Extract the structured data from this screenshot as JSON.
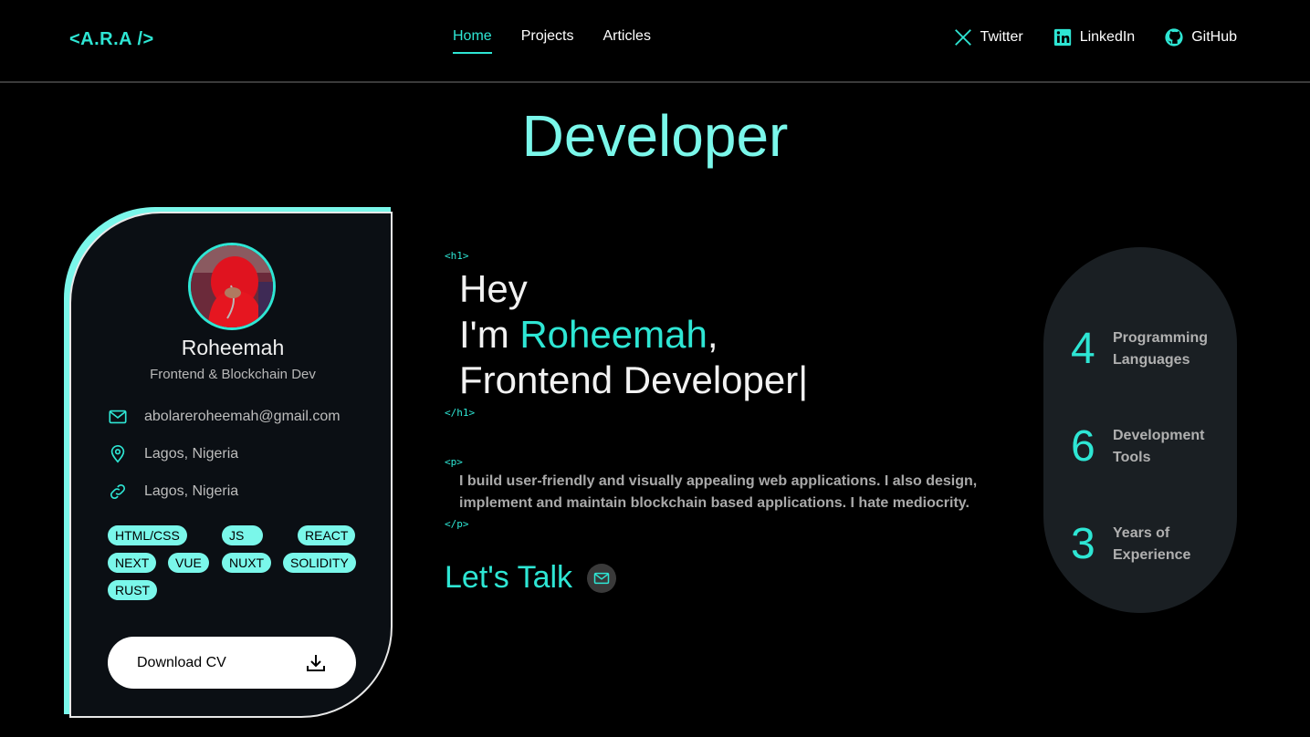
{
  "header": {
    "logo": "<A.R.A />",
    "nav": [
      {
        "label": "Home",
        "active": true
      },
      {
        "label": "Projects",
        "active": false
      },
      {
        "label": "Articles",
        "active": false
      }
    ],
    "social": [
      {
        "label": "Twitter",
        "icon": "x-icon"
      },
      {
        "label": "LinkedIn",
        "icon": "linkedin-icon"
      },
      {
        "label": "GitHub",
        "icon": "github-icon"
      }
    ]
  },
  "hero_title": "Developer",
  "profile": {
    "name": "Roheemah",
    "role": "Frontend & Blockchain Dev",
    "email": "abolareroheemah@gmail.com",
    "location": "Lagos, Nigeria",
    "link": "Lagos, Nigeria",
    "skills": [
      "HTML/CSS",
      "JS",
      "REACT",
      "NEXT",
      "VUE",
      "NUXT",
      "SOLIDITY",
      "RUST"
    ],
    "download_label": "Download CV"
  },
  "intro": {
    "open_tag_h1": "<h1>",
    "line1": "Hey",
    "line2_prefix": "I'm ",
    "line2_name": "Roheemah",
    "line2_suffix": ",",
    "line3": "Frontend Developer",
    "cursor": "|",
    "close_tag_h1": "</h1>",
    "open_tag_p": "<p>",
    "bio": "I build user-friendly and visually appealing web applications. I also design, implement and maintain blockchain based applications. I hate mediocrity.",
    "close_tag_p": "</p>",
    "cta": "Let's Talk"
  },
  "stats": [
    {
      "value": "4",
      "label": "Programming Languages"
    },
    {
      "value": "6",
      "label": "Development Tools"
    },
    {
      "value": "3",
      "label": "Years of Experience"
    }
  ],
  "colors": {
    "accent": "#2ee6d4",
    "accent_light": "#7af7ea",
    "background": "#000000"
  }
}
